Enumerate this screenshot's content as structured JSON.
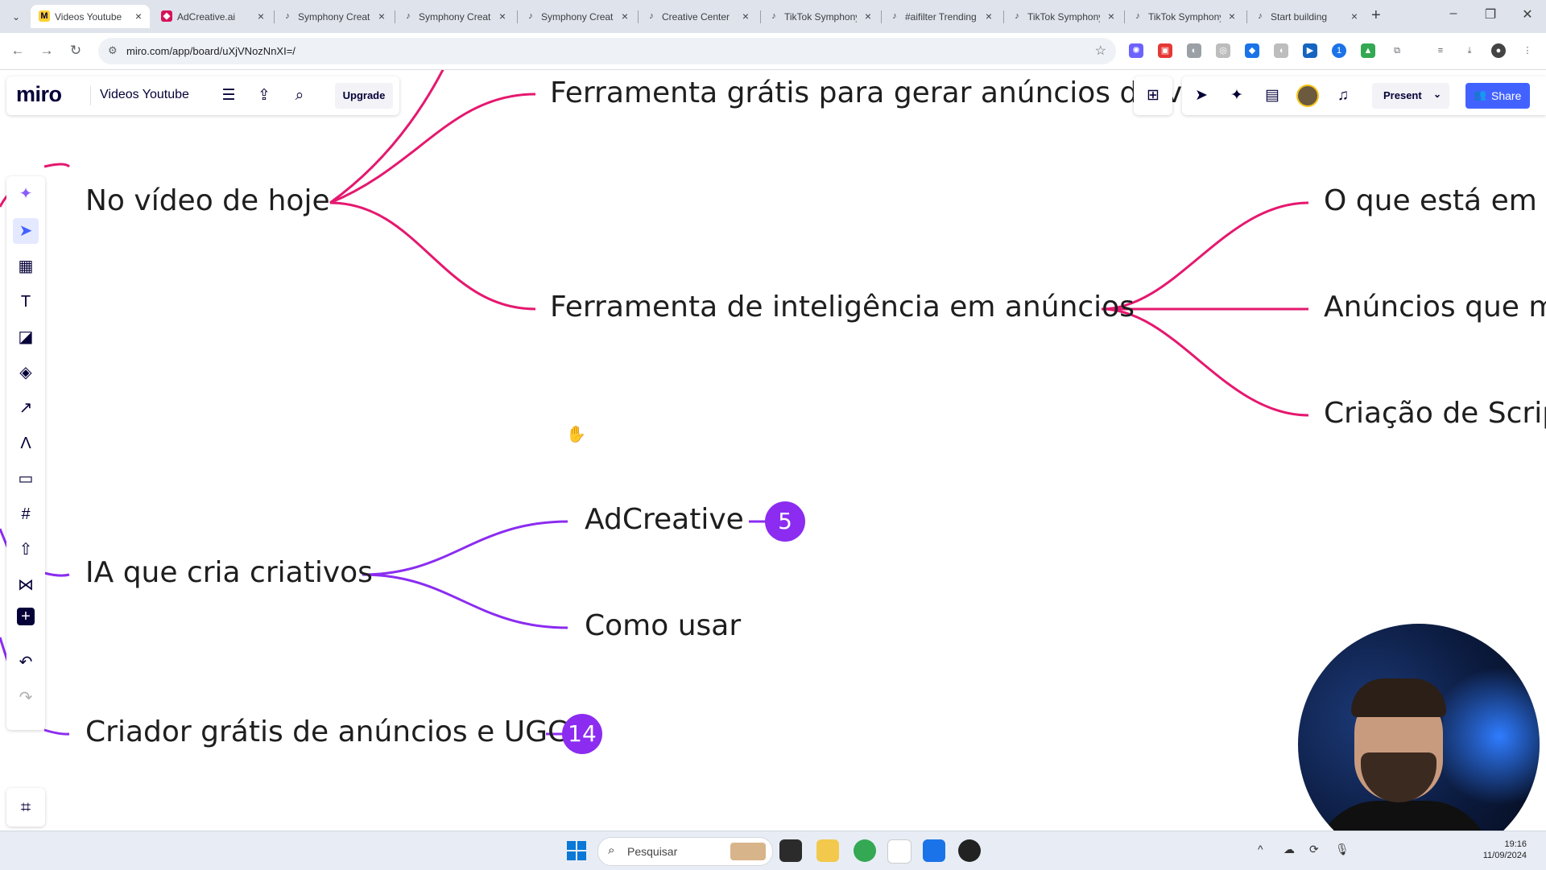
{
  "browser": {
    "tabs": [
      {
        "title": "Videos Youtube",
        "icon": "miro-icon",
        "active": true
      },
      {
        "title": "AdCreative.ai",
        "icon": "adcreative-icon"
      },
      {
        "title": "Symphony Creative",
        "icon": "tiktok-icon"
      },
      {
        "title": "Symphony Creative",
        "icon": "tiktok-icon"
      },
      {
        "title": "Symphony Creative",
        "icon": "tiktok-icon"
      },
      {
        "title": "Creative Center",
        "icon": "tiktok-icon"
      },
      {
        "title": "TikTok Symphony",
        "icon": "tiktok-icon"
      },
      {
        "title": "#aifilter Trending",
        "icon": "tiktok-icon"
      },
      {
        "title": "TikTok Symphony",
        "icon": "tiktok-icon"
      },
      {
        "title": "TikTok Symphony",
        "icon": "tiktok-icon"
      },
      {
        "title": "Start building",
        "icon": "tiktok-icon"
      }
    ],
    "url": "miro.com/app/board/uXjVNozNnXI=/"
  },
  "miro": {
    "logo": "miro",
    "board_name": "Videos Youtube",
    "upgrade_label": "Upgrade",
    "present_label": "Present",
    "share_label": "Share"
  },
  "mindmap": {
    "nodes": {
      "tool_free_ads": "Ferramenta grátis para gerar anúncios de vídeo",
      "today": "No vídeo de hoje",
      "intel_tool": "Ferramenta de inteligência em anúncios",
      "trending": "O que está em alta",
      "ads_best": "Anúncios que mais performam",
      "scripts": "Criação de Scripts",
      "adcreative": "AdCreative",
      "how_to": "Como usar",
      "ia_creatives": "IA que cria criativos",
      "free_creator": "Criador grátis de anúncios e UGC"
    },
    "badges": {
      "adcreative": "5",
      "free_creator": "14"
    },
    "colors": {
      "pink": "#e5186f",
      "purple": "#8b2cf0"
    }
  },
  "taskbar": {
    "search_placeholder": "Pesquisar",
    "time": "19:16",
    "date": "11/09/2024"
  }
}
